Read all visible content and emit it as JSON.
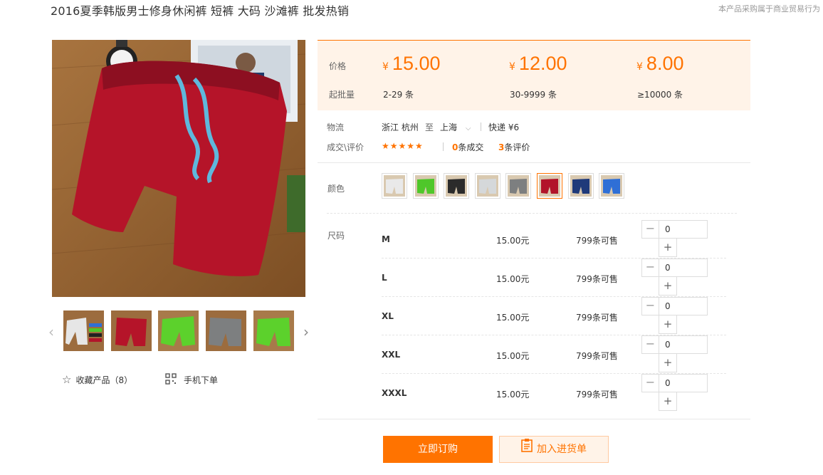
{
  "product": {
    "title": "2016夏季韩版男士修身休闲裤 短裤 大码 沙滩裤 批发热销",
    "notice": "本产品采购属于商业贸易行为"
  },
  "gallery": {
    "main_image": "red-shorts-product-photo",
    "thumbnails": [
      {
        "name": "multi-color-shorts-thumb"
      },
      {
        "name": "red-shorts-thumb"
      },
      {
        "name": "green-shorts-thumb"
      },
      {
        "name": "gray-shorts-thumb"
      },
      {
        "name": "green-shorts-thumb-2"
      }
    ]
  },
  "actions": {
    "favorite_label": "收藏产品（8）",
    "mobile_order_label": "手机下单"
  },
  "pricing": {
    "price_label": "价格",
    "moq_label": "起批量",
    "currency": "¥",
    "tiers": [
      {
        "price": "15.00",
        "range": "2-29 条"
      },
      {
        "price": "12.00",
        "range": "30-9999 条"
      },
      {
        "price": "8.00",
        "range": "≥10000 条"
      }
    ]
  },
  "logistics": {
    "label": "物流",
    "from": "浙江 杭州",
    "to_word": "至",
    "destination": "上海",
    "shipping": "快递 ¥6"
  },
  "deals": {
    "label": "成交\\评价",
    "stars": "★★★★★",
    "deal_count": "0",
    "deal_suffix": "条成交",
    "review_count": "3",
    "review_suffix": "条评价"
  },
  "color": {
    "label": "颜色",
    "swatches": [
      {
        "name": "white",
        "hex": "#e9e9e9"
      },
      {
        "name": "green",
        "hex": "#4fc72a"
      },
      {
        "name": "black",
        "hex": "#2b2b2b"
      },
      {
        "name": "light-gray",
        "hex": "#d5d8da"
      },
      {
        "name": "gray",
        "hex": "#7d7f80"
      },
      {
        "name": "red",
        "hex": "#b2142a",
        "selected": true
      },
      {
        "name": "navy",
        "hex": "#1f3a7a"
      },
      {
        "name": "blue",
        "hex": "#2f6fd6"
      }
    ]
  },
  "sizes": {
    "label": "尺码",
    "rows": [
      {
        "size": "M",
        "price": "15.00元",
        "stock": "799条可售",
        "qty": "0"
      },
      {
        "size": "L",
        "price": "15.00元",
        "stock": "799条可售",
        "qty": "0"
      },
      {
        "size": "XL",
        "price": "15.00元",
        "stock": "799条可售",
        "qty": "0"
      },
      {
        "size": "XXL",
        "price": "15.00元",
        "stock": "799条可售",
        "qty": "0"
      },
      {
        "size": "XXXL",
        "price": "15.00元",
        "stock": "799条可售",
        "qty": "0"
      }
    ],
    "minus": "−",
    "plus": "+"
  },
  "buttons": {
    "buy_now": "立即订购",
    "add_to_cart": "加入进货单"
  },
  "colors": {
    "accent": "#ff7300",
    "panel_bg": "#fff3e8"
  }
}
